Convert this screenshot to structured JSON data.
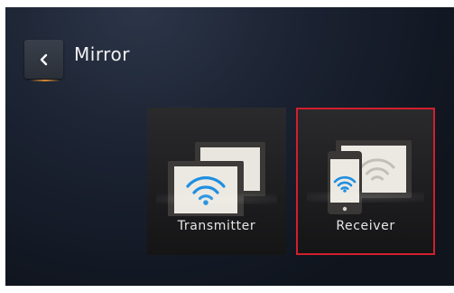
{
  "header": {
    "title": "Mirror",
    "back_icon": "chevron-left-icon"
  },
  "tiles": [
    {
      "label": "Transmitter",
      "icon": "screen-mirroring-wifi-icon",
      "selected": false
    },
    {
      "label": "Receiver",
      "icon": "phone-mirroring-wifi-icon",
      "selected": true
    }
  ],
  "colors": {
    "selection_border": "#d11f2c",
    "wifi_blue": "#1e8fe0",
    "accent_underline": "#d98b2c"
  }
}
